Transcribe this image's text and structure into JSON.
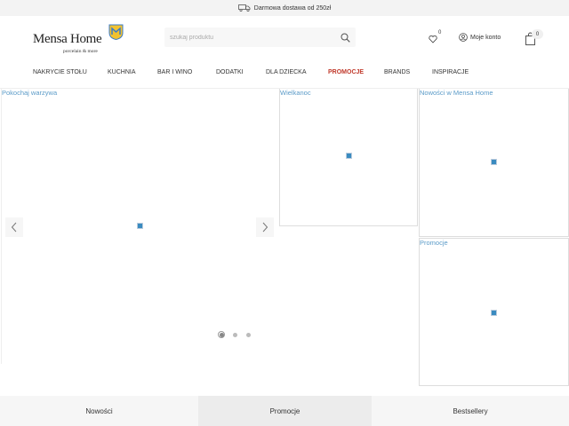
{
  "topbar": {
    "text": "Darmowa dostawa od 250zł",
    "icon": "truck-icon"
  },
  "header": {
    "logo": {
      "main": "Mensa Home",
      "sub": "porcelain & more",
      "badge_letter": "M"
    },
    "search": {
      "placeholder": "szukaj produktu",
      "value": ""
    },
    "wishlist": {
      "count": "0"
    },
    "account": {
      "label": "Moje konto"
    },
    "cart": {
      "count": "0"
    }
  },
  "nav": {
    "items": [
      {
        "label": "NAKRYCIE STOŁU"
      },
      {
        "label": "KUCHNIA"
      },
      {
        "label": "BAR I WINO"
      },
      {
        "label": "DODATKI"
      },
      {
        "label": "DLA DZIECKA"
      },
      {
        "label": "PROMOCJE"
      },
      {
        "label": "BRANDS"
      },
      {
        "label": "INSPIRACJE"
      }
    ]
  },
  "banners": {
    "main": {
      "label": "Pokochaj warzywa"
    },
    "wielkanoc": {
      "label": "Wielkanoc"
    },
    "nowosci": {
      "label": "Nowości w Mensa Home"
    },
    "promocje": {
      "label": "Promocje"
    }
  },
  "slider": {
    "slides": 3,
    "active": 1
  },
  "tabs": {
    "items": [
      {
        "label": "Nowości"
      },
      {
        "label": "Promocje"
      },
      {
        "label": "Bestsellery"
      }
    ],
    "active": 2
  },
  "colors": {
    "accent_link": "#5b9bc8",
    "promo": "#c0392b",
    "logo_badge": "#f2c230"
  }
}
